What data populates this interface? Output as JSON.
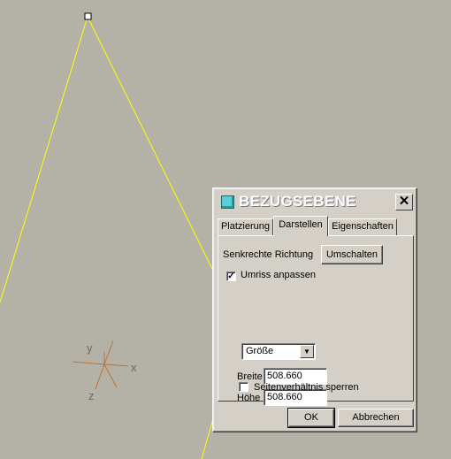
{
  "viewport": {
    "background": "#b4b2a6",
    "sketch_color": "#ffff00",
    "vertex_handle": "square-handle",
    "axes": {
      "x_label": "x",
      "y_label": "y",
      "z_label": "z",
      "color": "#b8743c"
    }
  },
  "dialog": {
    "title": "BEZUGSEBENE",
    "title_icon": "datum-plane-icon",
    "close_icon": "close-icon",
    "tabs": [
      {
        "label": "Platzierung",
        "active": false
      },
      {
        "label": "Darstellen",
        "active": true
      },
      {
        "label": "Eigenschaften",
        "active": false
      }
    ],
    "panel": {
      "normal_direction_label": "Senkrechte Richtung",
      "flip_button": "Umschalten",
      "fit_outline": {
        "label": "Umriss anpassen",
        "checked": true
      },
      "fit_type": {
        "selected": "Größe"
      },
      "width_label": "Breite",
      "width_value": "508.660",
      "height_label": "Höhe",
      "height_value": "508.660",
      "lock_ratio": {
        "label": "Seitenverhältnis sperren",
        "checked": false
      }
    },
    "ok_button": "OK",
    "cancel_button": "Abbrechen"
  }
}
